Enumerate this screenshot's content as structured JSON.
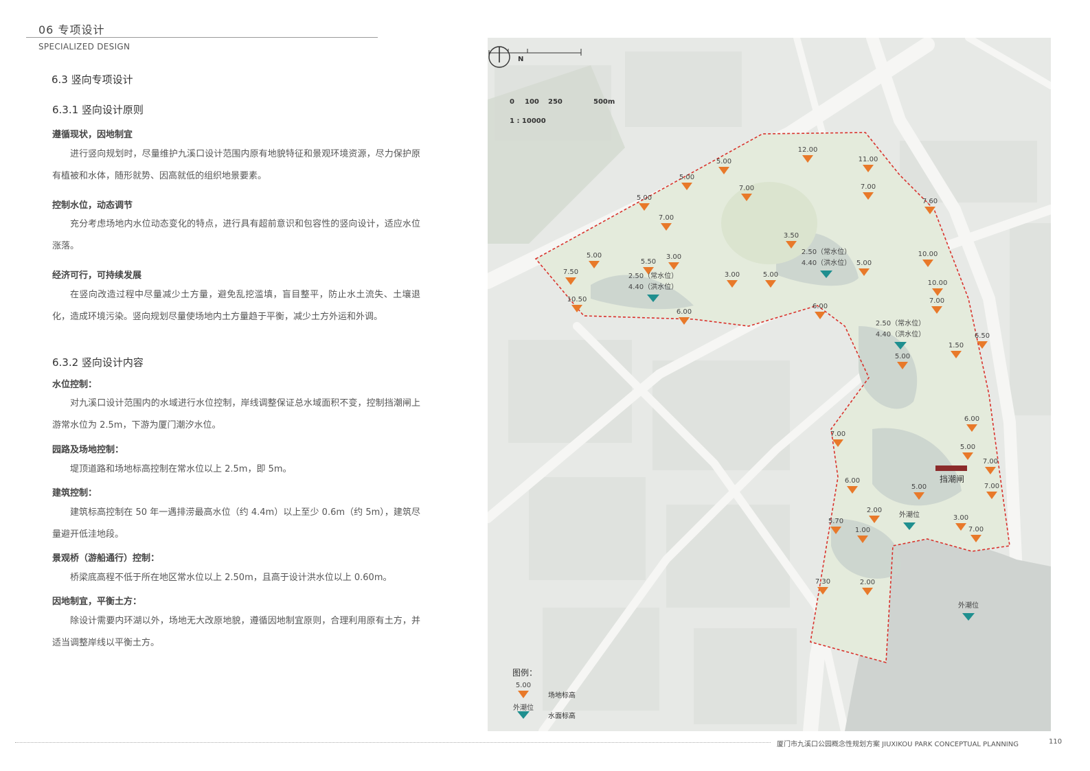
{
  "header": {
    "title": "06 专项设计",
    "subtitle": "SPECIALIZED DESIGN"
  },
  "section": {
    "heading": "6.3  竖向专项设计",
    "sub1": {
      "heading": "6.3.1 竖向设计原则",
      "items": [
        {
          "title": "遵循现状，因地制宜",
          "text": "进行竖向规划时，尽量维护九溪口设计范围内原有地貌特征和景观环境资源，尽力保护原有植被和水体，随形就势、因高就低的组织地景要素。"
        },
        {
          "title": "控制水位，动态调节",
          "text": "充分考虑场地内水位动态变化的特点，进行具有超前意识和包容性的竖向设计，适应水位涨落。"
        },
        {
          "title": "经济可行，可持续发展",
          "text": "在竖向改造过程中尽量减少土方量，避免乱挖滥填，盲目整平，防止水土流失、土壤退化，造成环境污染。竖向规划尽量使场地内土方量趋于平衡，减少土方外运和外调。"
        }
      ]
    },
    "sub2": {
      "heading": "6.3.2 竖向设计内容",
      "items": [
        {
          "title": "水位控制：",
          "text": "对九溪口设计范围内的水域进行水位控制，岸线调整保证总水域面积不变，控制挡潮闸上游常水位为 2.5m，下游为厦门潮汐水位。"
        },
        {
          "title": "园路及场地控制：",
          "text": "堤顶道路和场地标高控制在常水位以上 2.5m，即 5m。"
        },
        {
          "title": "建筑控制：",
          "text": "建筑标高控制在 50 年一遇排涝最高水位（约 4.4m）以上至少 0.6m（约 5m），建筑尽量避开低洼地段。"
        },
        {
          "title": "景观桥（游船通行）控制：",
          "text": "桥梁底高程不低于所在地区常水位以上 2.50m，且高于设计洪水位以上 0.60m。"
        },
        {
          "title": "因地制宜，平衡土方：",
          "text": "除设计需要内环湖以外，场地无大改原地貌，遵循因地制宜原则，合理利用原有土方，并适当调整岸线以平衡土方。"
        }
      ]
    }
  },
  "map": {
    "north_label": "N",
    "scale": {
      "t0": "0",
      "t1": "100",
      "t2": "250",
      "t3": "500m",
      "ratio": "1 : 10000"
    },
    "elevations": [
      "12.00",
      "11.00",
      "5.00",
      "5.00",
      "7.00",
      "7.00",
      "7.60",
      "5.00",
      "7.00",
      "3.50",
      "10.00",
      "5.00",
      "5.50",
      "3.00",
      "7.50",
      "3.00",
      "5.00",
      "5.00",
      "10.50",
      "6.00",
      "10.00",
      "6.00",
      "7.00",
      "6.50",
      "1.50",
      "5.00",
      "6.00",
      "5.00",
      "7.00",
      "7.00",
      "6.00",
      "5.00",
      "7.00",
      "2.00",
      "3.00",
      "5.70",
      "1.00",
      "7.00",
      "7.30",
      "2.00"
    ],
    "water_levels": [
      {
        "line1": "2.50（常水位）",
        "line2": "4.40（洪水位）"
      },
      {
        "line1": "2.50（常水位）",
        "line2": "4.40（洪水位）"
      },
      {
        "line1": "2.50（常水位）",
        "line2": "4.40（洪水位）"
      },
      {
        "line1": "外潮位",
        "line2": ""
      },
      {
        "line1": "外潮位",
        "line2": ""
      }
    ],
    "gate_label": "挡潮闸",
    "legend": {
      "title": "图例：",
      "site_sample": "5.00",
      "site_label": "场地标高",
      "water_sample": "外潮位",
      "water_label": "水面标高"
    },
    "colors": {
      "site_marker": "#e8792a",
      "water_marker": "#1f8f8f",
      "boundary": "#d9312b",
      "gate": "#8b2b2b"
    }
  },
  "footer": {
    "text": "厦门市九溪口公园概念性规划方案 JIUXIKOU PARK CONCEPTUAL PLANNING",
    "page": "110"
  }
}
